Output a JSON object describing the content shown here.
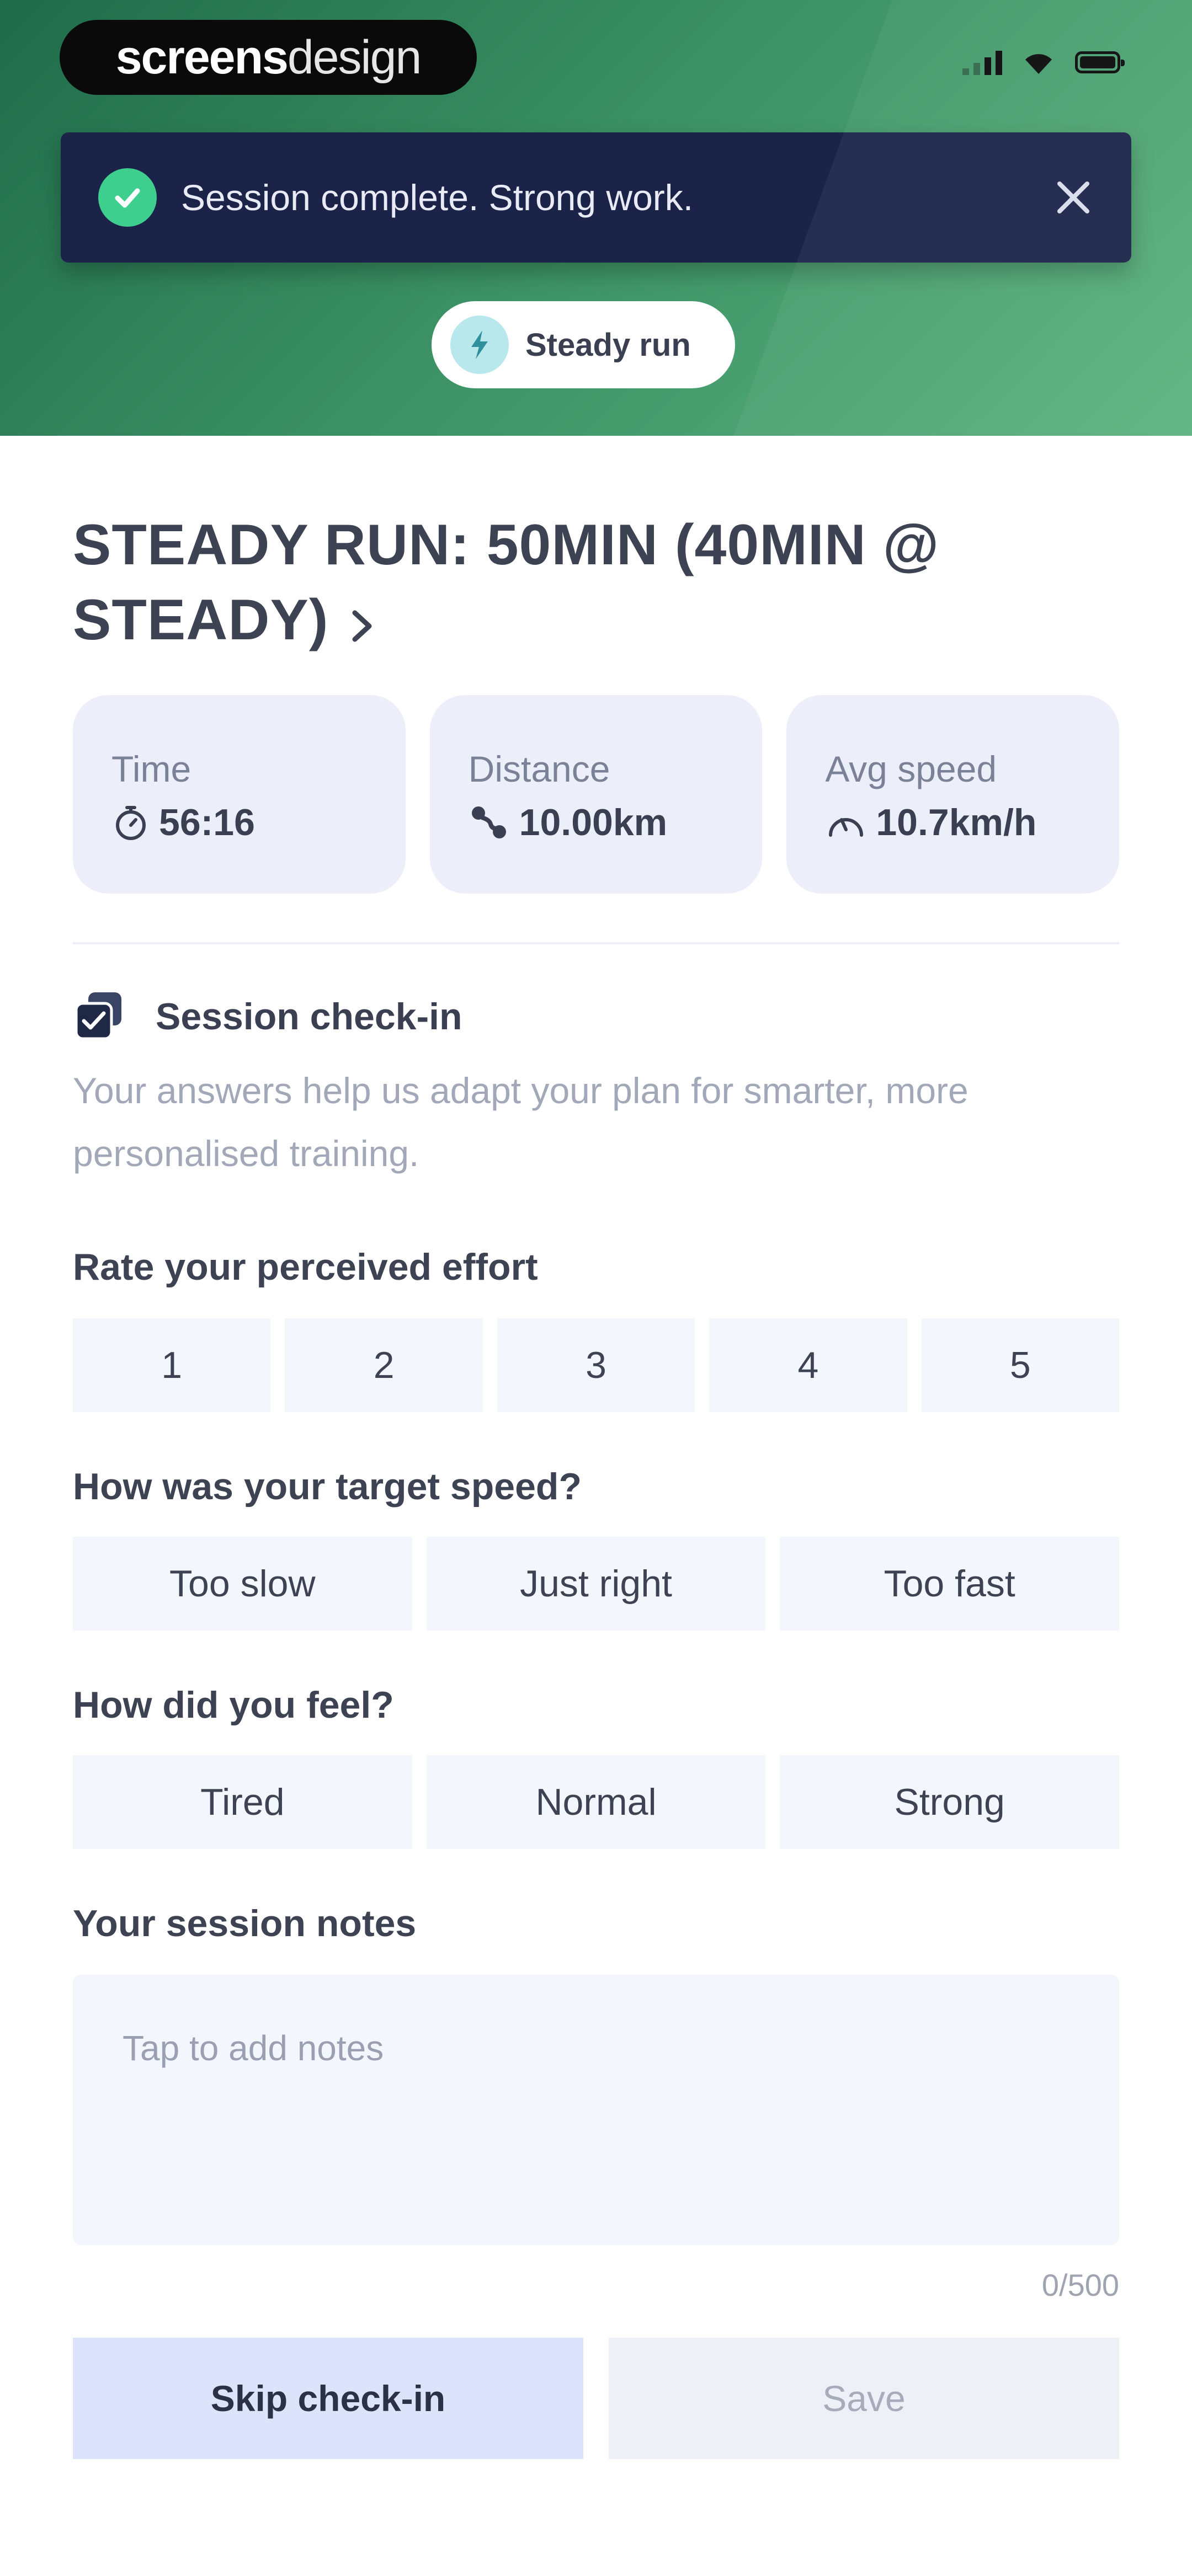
{
  "brand": {
    "logo_bold": "screens",
    "logo_light": "design"
  },
  "status_bar": {
    "signal_icon": "cellular-signal-icon",
    "wifi_icon": "wifi-icon",
    "battery_icon": "battery-icon"
  },
  "toast": {
    "message": "Session complete. Strong work.",
    "check_icon": "check-circle-icon",
    "close_icon": "close-icon",
    "accent_color": "#3ecf8e",
    "background_color": "#1b2349"
  },
  "session_chip": {
    "label": "Steady run",
    "icon": "lightning-icon"
  },
  "session": {
    "title": "STEADY RUN: 50MIN (40MIN @ STEADY)",
    "chevron_icon": "chevron-right-icon"
  },
  "stats": [
    {
      "label": "Time",
      "value": "56:16",
      "icon": "stopwatch-icon"
    },
    {
      "label": "Distance",
      "value": "10.00km",
      "icon": "route-icon"
    },
    {
      "label": "Avg speed",
      "value": "10.7km/h",
      "icon": "speedometer-icon"
    }
  ],
  "checkin": {
    "title": "Session check-in",
    "icon": "clipboard-check-icon",
    "description": "Your answers help us adapt your plan for smarter, more personalised training."
  },
  "effort": {
    "label": "Rate your perceived effort",
    "options": [
      "1",
      "2",
      "3",
      "4",
      "5"
    ]
  },
  "target_speed": {
    "label": "How was your target speed?",
    "options": [
      "Too slow",
      "Just right",
      "Too fast"
    ]
  },
  "feel": {
    "label": "How did you feel?",
    "options": [
      "Tired",
      "Normal",
      "Strong"
    ]
  },
  "notes": {
    "label": "Your session notes",
    "placeholder": "Tap to add notes",
    "counter": "0/500"
  },
  "actions": {
    "skip_label": "Skip check-in",
    "save_label": "Save"
  }
}
